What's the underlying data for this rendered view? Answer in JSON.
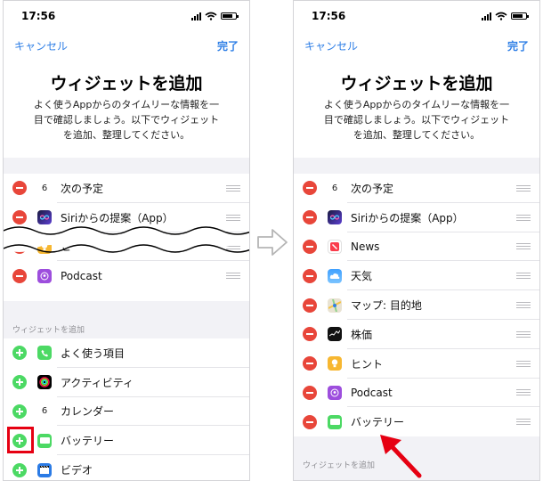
{
  "left": {
    "status_time": "17:56",
    "nav": {
      "cancel": "キャンセル",
      "done": "完了"
    },
    "title": "ウィジェットを追加",
    "desc_lines": [
      "よく使うAppからのタイムリーな情報を一",
      "目で確認しましょう。以下でウィジェット",
      "を追加、整理してください。"
    ],
    "active": [
      {
        "label": "次の予定",
        "icon": "calendar-icon",
        "icon_text": "6"
      },
      {
        "label": "Siriからの提案（App）",
        "icon": "siri-icon"
      },
      {
        "label": "ヒント",
        "icon": "tips-icon"
      },
      {
        "label": "Podcast",
        "icon": "podcast-icon"
      }
    ],
    "section_header": "ウィジェットを追加",
    "available": [
      {
        "label": "よく使う項目",
        "icon": "phone-icon"
      },
      {
        "label": "アクティビティ",
        "icon": "activity-icon"
      },
      {
        "label": "カレンダー",
        "icon": "calendar-icon",
        "icon_text": "6"
      },
      {
        "label": "バッテリー",
        "icon": "battery-icon"
      },
      {
        "label": "ビデオ",
        "icon": "video-icon"
      }
    ]
  },
  "right": {
    "status_time": "17:56",
    "nav": {
      "cancel": "キャンセル",
      "done": "完了"
    },
    "title": "ウィジェットを追加",
    "desc_lines": [
      "よく使うAppからのタイムリーな情報を一",
      "目で確認しましょう。以下でウィジェット",
      "を追加、整理してください。"
    ],
    "active": [
      {
        "label": "次の予定",
        "icon": "calendar-icon",
        "icon_text": "6"
      },
      {
        "label": "Siriからの提案（App）",
        "icon": "siri-icon"
      },
      {
        "label": "News",
        "icon": "news-icon"
      },
      {
        "label": "天気",
        "icon": "weather-icon"
      },
      {
        "label": "マップ: 目的地",
        "icon": "maps-icon"
      },
      {
        "label": "株価",
        "icon": "stocks-icon"
      },
      {
        "label": "ヒント",
        "icon": "tips-icon"
      },
      {
        "label": "Podcast",
        "icon": "podcast-icon"
      },
      {
        "label": "バッテリー",
        "icon": "battery-icon"
      }
    ],
    "section_header": "ウィジェットを追加"
  },
  "colors": {
    "accent": "#2f7fe6",
    "remove": "#e8463a",
    "add": "#4cd964",
    "highlight": "#e60012"
  }
}
